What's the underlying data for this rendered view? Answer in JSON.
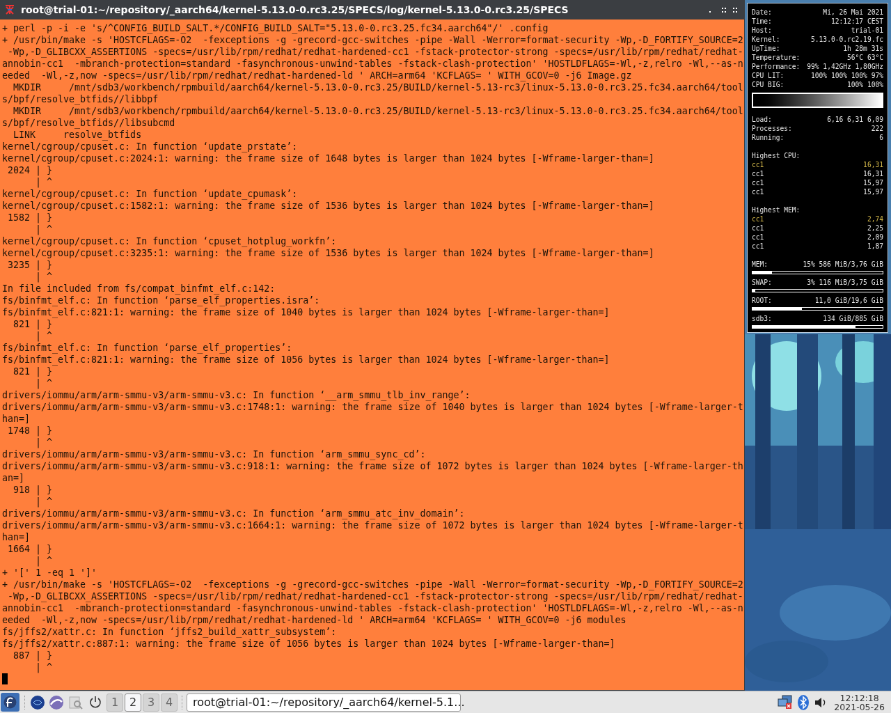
{
  "window": {
    "title": "root@trial-01:~/repository/_aarch64/kernel-5.13.0-0.rc3.25/SPECS/log/kernel-5.13.0-0.rc3.25/SPECS"
  },
  "terminal": {
    "lines": [
      "+ perl -p -i -e 's/^CONFIG_BUILD_SALT.*/CONFIG_BUILD_SALT=\"5.13.0-0.rc3.25.fc34.aarch64\"/' .config",
      "+ /usr/bin/make -s 'HOSTCFLAGS=-O2  -fexceptions -g -grecord-gcc-switches -pipe -Wall -Werror=format-security -Wp,-D_FORTIFY_SOURCE=2",
      " -Wp,-D_GLIBCXX_ASSERTIONS -specs=/usr/lib/rpm/redhat/redhat-hardened-cc1 -fstack-protector-strong -specs=/usr/lib/rpm/redhat/redhat-",
      "annobin-cc1  -mbranch-protection=standard -fasynchronous-unwind-tables -fstack-clash-protection' 'HOSTLDFLAGS=-Wl,-z,relro -Wl,--as-n",
      "eeded  -Wl,-z,now -specs=/usr/lib/rpm/redhat/redhat-hardened-ld ' ARCH=arm64 'KCFLAGS= ' WITH_GCOV=0 -j6 Image.gz",
      "  MKDIR     /mnt/sdb3/workbench/rpmbuild/aarch64/kernel-5.13.0-0.rc3.25/BUILD/kernel-5.13-rc3/linux-5.13.0-0.rc3.25.fc34.aarch64/tool",
      "s/bpf/resolve_btfids//libbpf",
      "  MKDIR     /mnt/sdb3/workbench/rpmbuild/aarch64/kernel-5.13.0-0.rc3.25/BUILD/kernel-5.13-rc3/linux-5.13.0-0.rc3.25.fc34.aarch64/tool",
      "s/bpf/resolve_btfids//libsubcmd",
      "  LINK     resolve_btfids",
      "kernel/cgroup/cpuset.c: In function ‘update_prstate’:",
      "kernel/cgroup/cpuset.c:2024:1: warning: the frame size of 1648 bytes is larger than 1024 bytes [-Wframe-larger-than=]",
      " 2024 | }",
      "      | ^",
      "kernel/cgroup/cpuset.c: In function ‘update_cpumask’:",
      "kernel/cgroup/cpuset.c:1582:1: warning: the frame size of 1536 bytes is larger than 1024 bytes [-Wframe-larger-than=]",
      " 1582 | }",
      "      | ^",
      "kernel/cgroup/cpuset.c: In function ‘cpuset_hotplug_workfn’:",
      "kernel/cgroup/cpuset.c:3235:1: warning: the frame size of 1536 bytes is larger than 1024 bytes [-Wframe-larger-than=]",
      " 3235 | }",
      "      | ^",
      "In file included from fs/compat_binfmt_elf.c:142:",
      "fs/binfmt_elf.c: In function ‘parse_elf_properties.isra’:",
      "fs/binfmt_elf.c:821:1: warning: the frame size of 1040 bytes is larger than 1024 bytes [-Wframe-larger-than=]",
      "  821 | }",
      "      | ^",
      "fs/binfmt_elf.c: In function ‘parse_elf_properties’:",
      "fs/binfmt_elf.c:821:1: warning: the frame size of 1056 bytes is larger than 1024 bytes [-Wframe-larger-than=]",
      "  821 | }",
      "      | ^",
      "drivers/iommu/arm/arm-smmu-v3/arm-smmu-v3.c: In function ‘__arm_smmu_tlb_inv_range’:",
      "drivers/iommu/arm/arm-smmu-v3/arm-smmu-v3.c:1748:1: warning: the frame size of 1040 bytes is larger than 1024 bytes [-Wframe-larger-t",
      "han=]",
      " 1748 | }",
      "      | ^",
      "drivers/iommu/arm/arm-smmu-v3/arm-smmu-v3.c: In function ‘arm_smmu_sync_cd’:",
      "drivers/iommu/arm/arm-smmu-v3/arm-smmu-v3.c:918:1: warning: the frame size of 1072 bytes is larger than 1024 bytes [-Wframe-larger-th",
      "an=]",
      "  918 | }",
      "      | ^",
      "drivers/iommu/arm/arm-smmu-v3/arm-smmu-v3.c: In function ‘arm_smmu_atc_inv_domain’:",
      "drivers/iommu/arm/arm-smmu-v3/arm-smmu-v3.c:1664:1: warning: the frame size of 1072 bytes is larger than 1024 bytes [-Wframe-larger-t",
      "han=]",
      " 1664 | }",
      "      | ^",
      "+ '[' 1 -eq 1 ']'",
      "+ /usr/bin/make -s 'HOSTCFLAGS=-O2  -fexceptions -g -grecord-gcc-switches -pipe -Wall -Werror=format-security -Wp,-D_FORTIFY_SOURCE=2",
      " -Wp,-D_GLIBCXX_ASSERTIONS -specs=/usr/lib/rpm/redhat/redhat-hardened-cc1 -fstack-protector-strong -specs=/usr/lib/rpm/redhat/redhat-",
      "annobin-cc1  -mbranch-protection=standard -fasynchronous-unwind-tables -fstack-clash-protection' 'HOSTLDFLAGS=-Wl,-z,relro -Wl,--as-n",
      "eeded  -Wl,-z,now -specs=/usr/lib/rpm/redhat/redhat-hardened-ld ' ARCH=arm64 'KCFLAGS= ' WITH_GCOV=0 -j6 modules",
      "fs/jffs2/xattr.c: In function ‘jffs2_build_xattr_subsystem’:",
      "fs/jffs2/xattr.c:887:1: warning: the frame size of 1056 bytes is larger than 1024 bytes [-Wframe-larger-than=]",
      "  887 | }",
      "      | ^"
    ],
    "cursor_visible": true
  },
  "system_monitor": {
    "info": [
      {
        "label": "Date:",
        "value": "Mi, 26 Mai 2021"
      },
      {
        "label": "Time:",
        "value": "12:12:17 CEST"
      },
      {
        "label": "Host:",
        "value": "trial-01"
      },
      {
        "label": "Kernel:",
        "value": "5.13.0-0.rc2.19.fc"
      },
      {
        "label": "UpTime:",
        "value": "1h 28m 31s"
      },
      {
        "label": "Temperature:",
        "value": "56°C 63°C"
      },
      {
        "label": "Performance:",
        "value": "99% 1,42GHz 1,80GHz"
      },
      {
        "label": "CPU LIT:",
        "value": "100% 100% 100% 97%"
      },
      {
        "label": "CPU BIG:",
        "value": "100% 100%"
      }
    ],
    "load": [
      {
        "label": "Load:",
        "value": "6,16 6,31 6,09"
      },
      {
        "label": "Processes:",
        "value": "222"
      },
      {
        "label": "Running:",
        "value": "6"
      }
    ],
    "top_lists": [
      {
        "title": "Highest CPU:",
        "processes": [
          {
            "name": "cc1",
            "value": "16,31",
            "top": true
          },
          {
            "name": "cc1",
            "value": "16,31",
            "top": false
          },
          {
            "name": "cc1",
            "value": "15,97",
            "top": false
          },
          {
            "name": "cc1",
            "value": "15,97",
            "top": false
          }
        ]
      },
      {
        "title": "Highest MEM:",
        "processes": [
          {
            "name": "cc1",
            "value": "2,74",
            "top": true
          },
          {
            "name": "cc1",
            "value": "2,25",
            "top": false
          },
          {
            "name": "cc1",
            "value": "2,09",
            "top": false
          },
          {
            "name": "cc1",
            "value": "1,87",
            "top": false
          }
        ]
      }
    ],
    "usage": [
      {
        "label": "MEM:",
        "value": "15% 586 MiB/3,76 GiB",
        "level": 0.15
      },
      {
        "label": "SWAP:",
        "value": "3% 116 MiB/3,75 GiB",
        "level": 0.02
      },
      {
        "label": "ROOT:",
        "value": "11,0 GiB/19,6 GiB",
        "level": 0.38
      },
      {
        "label": "sdb3:",
        "value": "134 GiB/885 GiB",
        "level": 0.79
      }
    ]
  },
  "taskbar": {
    "workspaces": [
      {
        "label": "1",
        "selected": false
      },
      {
        "label": "2",
        "selected": true
      },
      {
        "label": "3",
        "selected": false
      },
      {
        "label": "4",
        "selected": false
      }
    ],
    "task": {
      "title": "root@trial-01:~/repository/_aarch64/kernel-5.1..."
    },
    "clock": {
      "time": "12:12:18",
      "date": "2021-05-26"
    }
  }
}
